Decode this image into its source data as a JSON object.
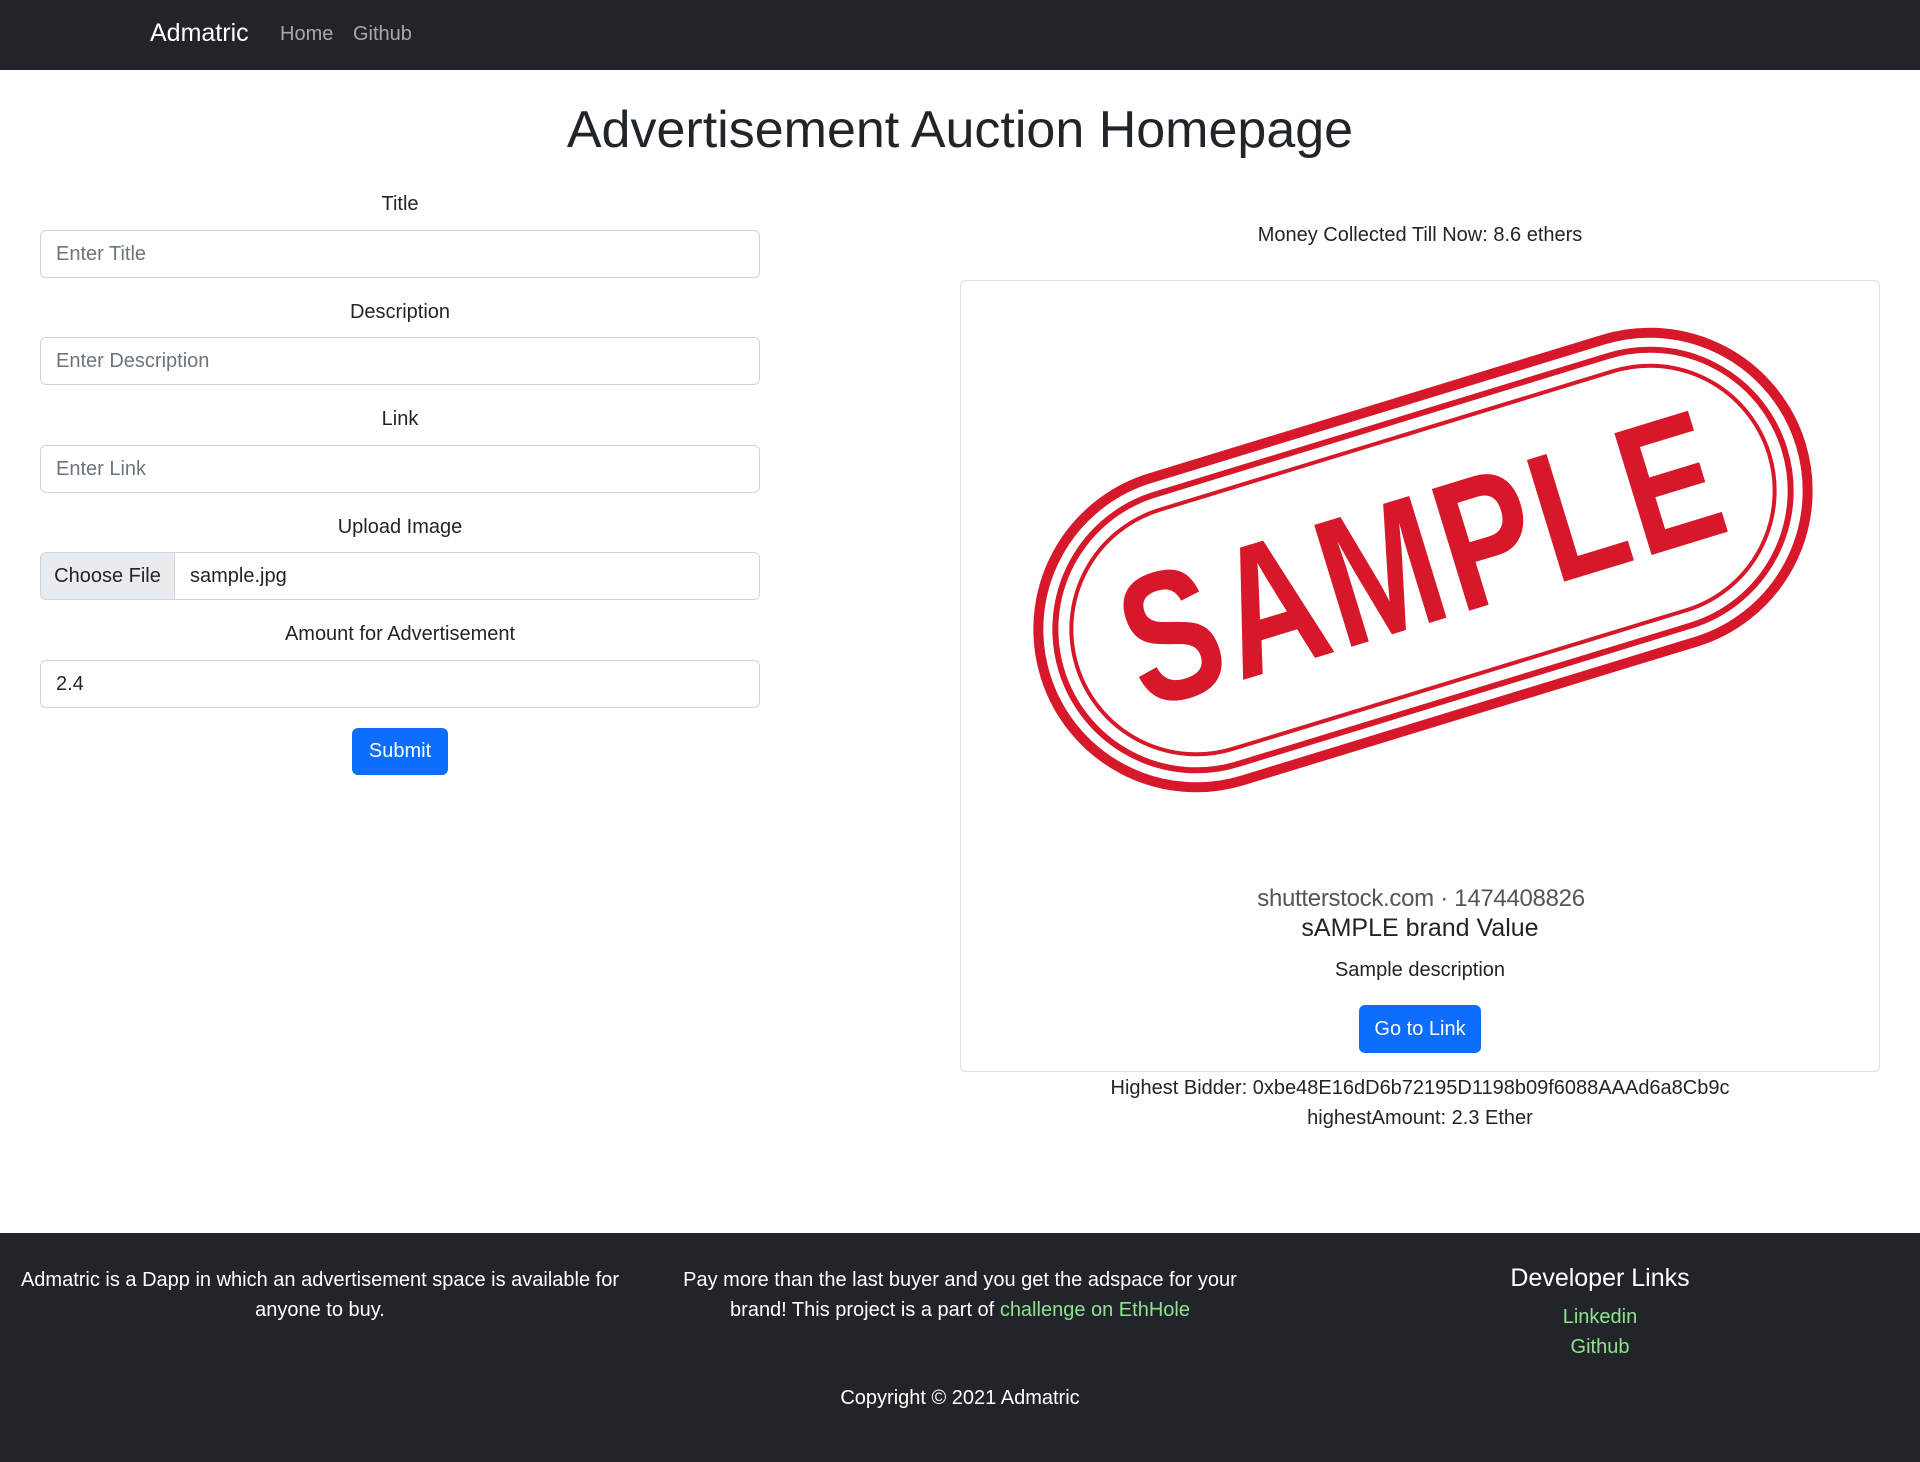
{
  "navbar": {
    "brand": "Admatric",
    "links": [
      {
        "label": "Home"
      },
      {
        "label": "Github"
      }
    ]
  },
  "page_title": "Advertisement Auction Homepage",
  "form": {
    "title": {
      "label": "Title",
      "placeholder": "Enter Title",
      "value": ""
    },
    "description": {
      "label": "Description",
      "placeholder": "Enter Description",
      "value": ""
    },
    "link": {
      "label": "Link",
      "placeholder": "Enter Link",
      "value": ""
    },
    "upload": {
      "label": "Upload Image",
      "button": "Choose File",
      "file_name": "sample.jpg"
    },
    "amount": {
      "label": "Amount for Advertisement",
      "value": "2.4"
    },
    "submit_label": "Submit"
  },
  "auction": {
    "money_collected": "Money Collected Till Now: 8.6 ethers",
    "card": {
      "image_text": "SAMPLE",
      "watermark": "shutterstock.com · 1474408826",
      "title": "sAMPLE brand Value",
      "description": "Sample description",
      "button_label": "Go to Link"
    },
    "highest_bidder": "Highest Bidder: 0xbe48E16dD6b72195D1198b09f6088AAAd6a8Cb9c",
    "highest_amount": "highestAmount: 2.3 Ether"
  },
  "footer": {
    "about": "Admatric is a Dapp in which an advertisement space is available for anyone to buy.",
    "pitch_text": "Pay more than the last buyer and you get the adspace for your brand! This project is a part of",
    "pitch_link": "challenge on EthHole",
    "developer_links_title": "Developer Links",
    "developer_links": [
      {
        "label": "Linkedin"
      },
      {
        "label": "Github"
      }
    ],
    "copyright": "Copyright © 2021 Admatric"
  },
  "colors": {
    "navbar_bg": "#212529",
    "primary": "#0d6efd",
    "stamp_red": "#d7182a",
    "footer_link": "#8fe28f"
  }
}
